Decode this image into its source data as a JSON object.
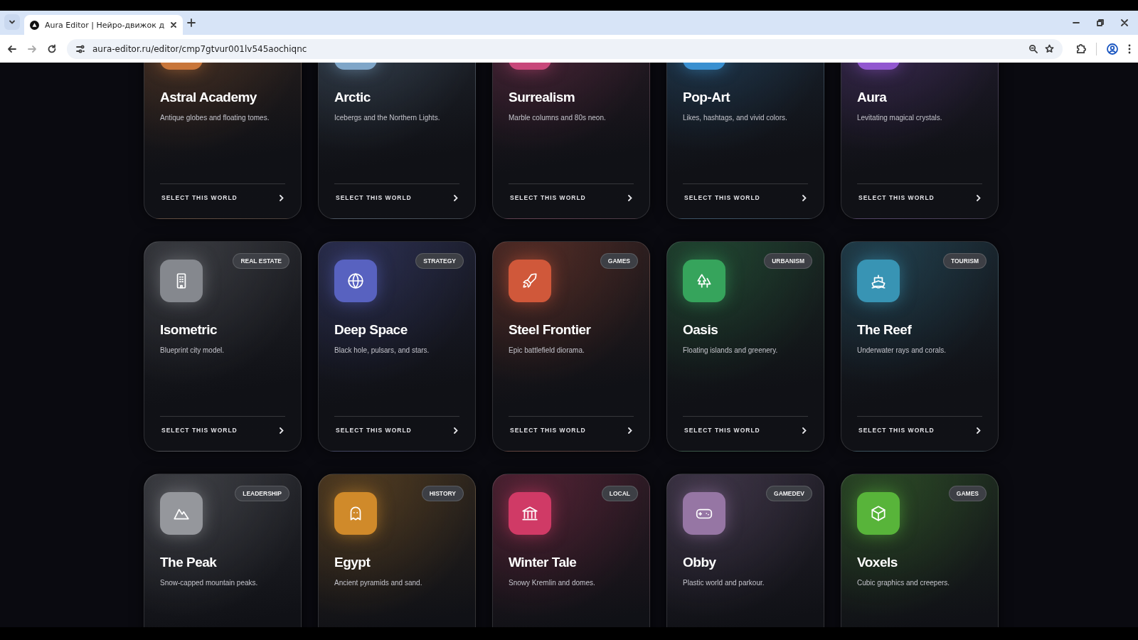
{
  "browser": {
    "tab": {
      "title": "Aura Editor | Нейро-движок д",
      "selected": true
    },
    "address": "aura-editor.ru/editor/cmp7gtvur001lv545aochiqnc"
  },
  "worlds": [
    {
      "title": "Astral Academy",
      "description": "Antique globes and floating tomes.",
      "action": "SELECT THIS WORLD",
      "color": "#c8763a"
    },
    {
      "title": "Arctic",
      "description": "Icebergs and the Northern Lights.",
      "action": "SELECT THIS WORLD",
      "color": "#7fa6c8"
    },
    {
      "title": "Surrealism",
      "description": "Marble columns and 80s neon.",
      "action": "SELECT THIS WORLD",
      "color": "#c8487a"
    },
    {
      "title": "Pop-Art",
      "description": "Likes, hashtags, and vivid colors.",
      "action": "SELECT THIS WORLD",
      "color": "#3a90d0"
    },
    {
      "title": "Aura",
      "description": "Levitating magical crystals.",
      "action": "SELECT THIS WORLD",
      "color": "#9258d0"
    },
    {
      "title": "Isometric",
      "description": "Blueprint city model.",
      "category": "REAL ESTATE",
      "action": "SELECT THIS WORLD",
      "color": "#85888e"
    },
    {
      "title": "Deep Space",
      "description": "Black hole, pulsars, and stars.",
      "category": "STRATEGY",
      "action": "SELECT THIS WORLD",
      "color": "#5862c0"
    },
    {
      "title": "Steel Frontier",
      "description": "Epic battlefield diorama.",
      "category": "GAMES",
      "action": "SELECT THIS WORLD",
      "color": "#d0583a"
    },
    {
      "title": "Oasis",
      "description": "Floating islands and greenery.",
      "category": "URBANISM",
      "action": "SELECT THIS WORLD",
      "color": "#36a45c"
    },
    {
      "title": "The Reef",
      "description": "Underwater rays and corals.",
      "category": "TOURISM",
      "action": "SELECT THIS WORLD",
      "color": "#3894b4"
    },
    {
      "title": "The Peak",
      "description": "Snow-capped mountain peaks.",
      "category": "LEADERSHIP",
      "color": "#95979c"
    },
    {
      "title": "Egypt",
      "description": "Ancient pyramids and sand.",
      "category": "HISTORY",
      "color": "#d08a2a"
    },
    {
      "title": "Winter Tale",
      "description": "Snowy Kremlin and domes.",
      "category": "LOCAL",
      "color": "#d03a66"
    },
    {
      "title": "Obby",
      "description": "Plastic world and parkour.",
      "category": "GAMEDEV",
      "color": "#9676a4"
    },
    {
      "title": "Voxels",
      "description": "Cubic graphics and creepers.",
      "category": "GAMES",
      "color": "#58b43a"
    }
  ]
}
